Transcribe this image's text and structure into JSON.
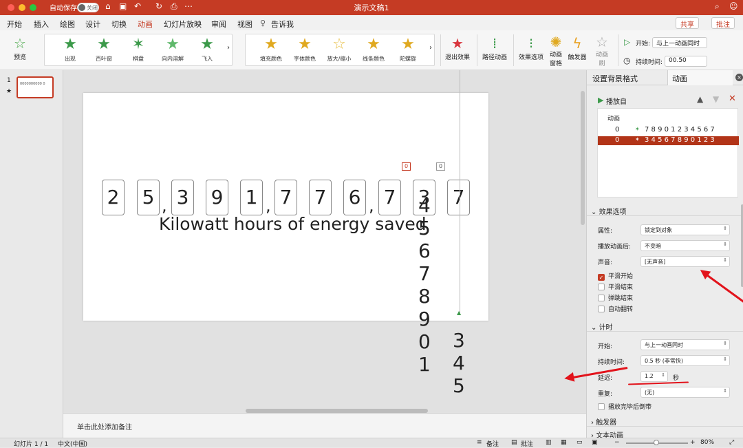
{
  "titlebar": {
    "autosave_label": "自动保存",
    "toggle_text": "关闭",
    "doc_title": "演示文稿1"
  },
  "tabs": [
    {
      "label": "开始"
    },
    {
      "label": "插入"
    },
    {
      "label": "绘图"
    },
    {
      "label": "设计"
    },
    {
      "label": "切换"
    },
    {
      "label": "动画"
    },
    {
      "label": "幻灯片放映"
    },
    {
      "label": "审阅"
    },
    {
      "label": "视图"
    },
    {
      "label": "告诉我"
    }
  ],
  "header_buttons": {
    "share": "共享",
    "comment": "批注"
  },
  "ribbon": {
    "preview": "预览",
    "entrance_effects": [
      {
        "label": "出现"
      },
      {
        "label": "百叶窗"
      },
      {
        "label": "棋盘"
      },
      {
        "label": "向内溶解"
      },
      {
        "label": "飞入"
      }
    ],
    "emphasis_effects": [
      {
        "label": "填充颜色"
      },
      {
        "label": "字体颜色"
      },
      {
        "label": "放大/缩小"
      },
      {
        "label": "线条颜色"
      },
      {
        "label": "陀螺旋"
      }
    ],
    "exit_effect": "退出效果",
    "path_animation": "路径动画",
    "effect_options": "效果选项",
    "animation_pane_1": "动画",
    "animation_pane_2": "窗格",
    "trigger": "触发器",
    "animate_brush_1": "动画",
    "animate_brush_2": "刷",
    "start_label": "开始:",
    "start_value": "与上一动画同时",
    "duration_label": "持续时间:",
    "duration_value": "00.50"
  },
  "thumbnail": {
    "number": "1",
    "text": "0000000000 0"
  },
  "slide": {
    "digits": [
      {
        "d": "2"
      },
      {
        "d": "5"
      },
      {
        "d": "3"
      },
      {
        "d": "9"
      },
      {
        "d": "1"
      },
      {
        "d": "7"
      },
      {
        "d": "7"
      },
      {
        "d": "6"
      },
      {
        "d": "7"
      },
      {
        "d": "3"
      },
      {
        "d": "7"
      }
    ],
    "comma": ",",
    "subtitle": "Kilowatt hours of energy saved",
    "seq1": [
      "4",
      "5",
      "6",
      "7",
      "8",
      "9",
      "0",
      "1"
    ],
    "seq2": [
      "3",
      "4",
      "5"
    ],
    "tag": "0"
  },
  "notes_placeholder": "单击此处添加备注",
  "panel": {
    "tab1": "设置背景格式",
    "tab2": "动画",
    "play_from": "播放自",
    "list_header": "动画",
    "items": [
      {
        "num": "0",
        "text": "7 8 9 0 1 2 3 4 5 6 7"
      },
      {
        "num": "0",
        "text": "3 4 5 6 7 8 9 0 1 2 3"
      }
    ],
    "effect_options": "效果选项",
    "prop_label": "属性:",
    "prop_value": "锁定到对象",
    "after_label": "播放动画后:",
    "after_value": "不变暗",
    "sound_label": "声音:",
    "sound_value": "[无声音]",
    "checks": [
      {
        "label": "平滑开始"
      },
      {
        "label": "平滑结束"
      },
      {
        "label": "弹跳结束"
      },
      {
        "label": "自动翻转"
      }
    ],
    "timing": "计时",
    "t_start_label": "开始:",
    "t_start_value": "与上一动画同时",
    "t_dur_label": "持续时间:",
    "t_dur_value": "0.5 秒 (非常快)",
    "delay_label": "延迟:",
    "delay_value": "1.2",
    "delay_unit": "秒",
    "repeat_label": "重复:",
    "repeat_value": "(无)",
    "rewind": "播放完毕后倒带",
    "triggers": "触发器",
    "text_anim": "文本动画"
  },
  "status": {
    "slide": "幻灯片 1 / 1",
    "lang": "中文(中国)",
    "notes": "备注",
    "comments": "批注",
    "zoom": "80%"
  }
}
